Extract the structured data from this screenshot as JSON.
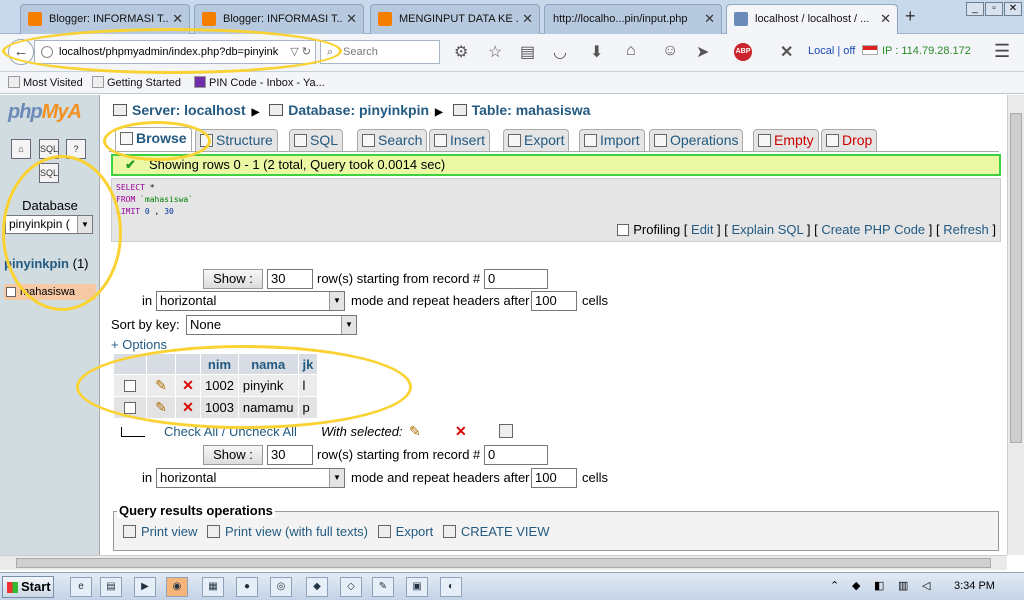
{
  "browser": {
    "tabs": [
      {
        "title": "Blogger: INFORMASI T...",
        "active": false,
        "color": "#f57d00"
      },
      {
        "title": "Blogger: INFORMASI T...",
        "active": false,
        "color": "#f57d00"
      },
      {
        "title": "MENGINPUT DATA KE ...",
        "active": false,
        "color": "#f57d00"
      },
      {
        "title": "http://localho...pin/input.php",
        "active": false,
        "color": ""
      },
      {
        "title": "localhost / localhost / ...",
        "active": true,
        "color": "#6c8ab7"
      }
    ],
    "url": "localhost/phpmyadmin/index.php?db=pinyink",
    "search_placeholder": "Search",
    "status_local": "Local | off",
    "status_ip": "IP : 114.79.28.172",
    "bookmarks": [
      "Most Visited",
      "Getting Started",
      "PIN Code - Inbox - Ya..."
    ]
  },
  "nav": {
    "logo_php": "php",
    "logo_my": "MyA",
    "database_label": "Database",
    "database_selected": "pinyinkpin (",
    "db_name": "pinyinkpin",
    "db_count": "(1)",
    "table": "mahasiswa"
  },
  "breadcrumb": {
    "server": "Server: localhost",
    "database": "Database: pinyinkpin",
    "table": "Table: mahasiswa"
  },
  "tabs": [
    "Browse",
    "Structure",
    "SQL",
    "Search",
    "Insert",
    "Export",
    "Import",
    "Operations",
    "Empty",
    "Drop"
  ],
  "message": "Showing rows 0 - 1 (2 total, Query took 0.0014 sec)",
  "sql": {
    "line1_kw": "SELECT",
    "line1_rest": " *",
    "line2_kw": "FROM",
    "line2_tbl": " `mahasiswa`",
    "line3_kw": "LIMIT",
    "line3_a": " 0",
    "line3_sep": " ,",
    "line3_b": " 30",
    "profiling": "Profiling",
    "edit": "Edit",
    "explain": "Explain SQL",
    "create_php": "Create PHP Code",
    "refresh": "Refresh"
  },
  "controls": {
    "show_btn": "Show :",
    "rows": "30",
    "rows_label": "row(s) starting from record #",
    "start": "0",
    "in": "in",
    "mode": "horizontal",
    "mode_label": "mode and repeat headers after",
    "repeat": "100",
    "cells": "cells",
    "sort_label": "Sort by key:",
    "sort_value": "None",
    "options": "+ Options"
  },
  "table": {
    "columns": [
      "nim",
      "nama",
      "jk"
    ],
    "rows": [
      {
        "nim": "1002",
        "nama": "pinyink",
        "jk": "l"
      },
      {
        "nim": "1003",
        "nama": "namamu",
        "jk": "p"
      }
    ]
  },
  "withsel": {
    "check_all": "Check All / Uncheck All",
    "with_selected": "With selected:"
  },
  "qro": {
    "legend": "Query results operations",
    "print_view": "Print view",
    "print_full": "Print view (with full texts)",
    "export": "Export",
    "create_view": "CREATE VIEW"
  },
  "taskbar": {
    "start": "Start",
    "clock": "3:34 PM"
  }
}
